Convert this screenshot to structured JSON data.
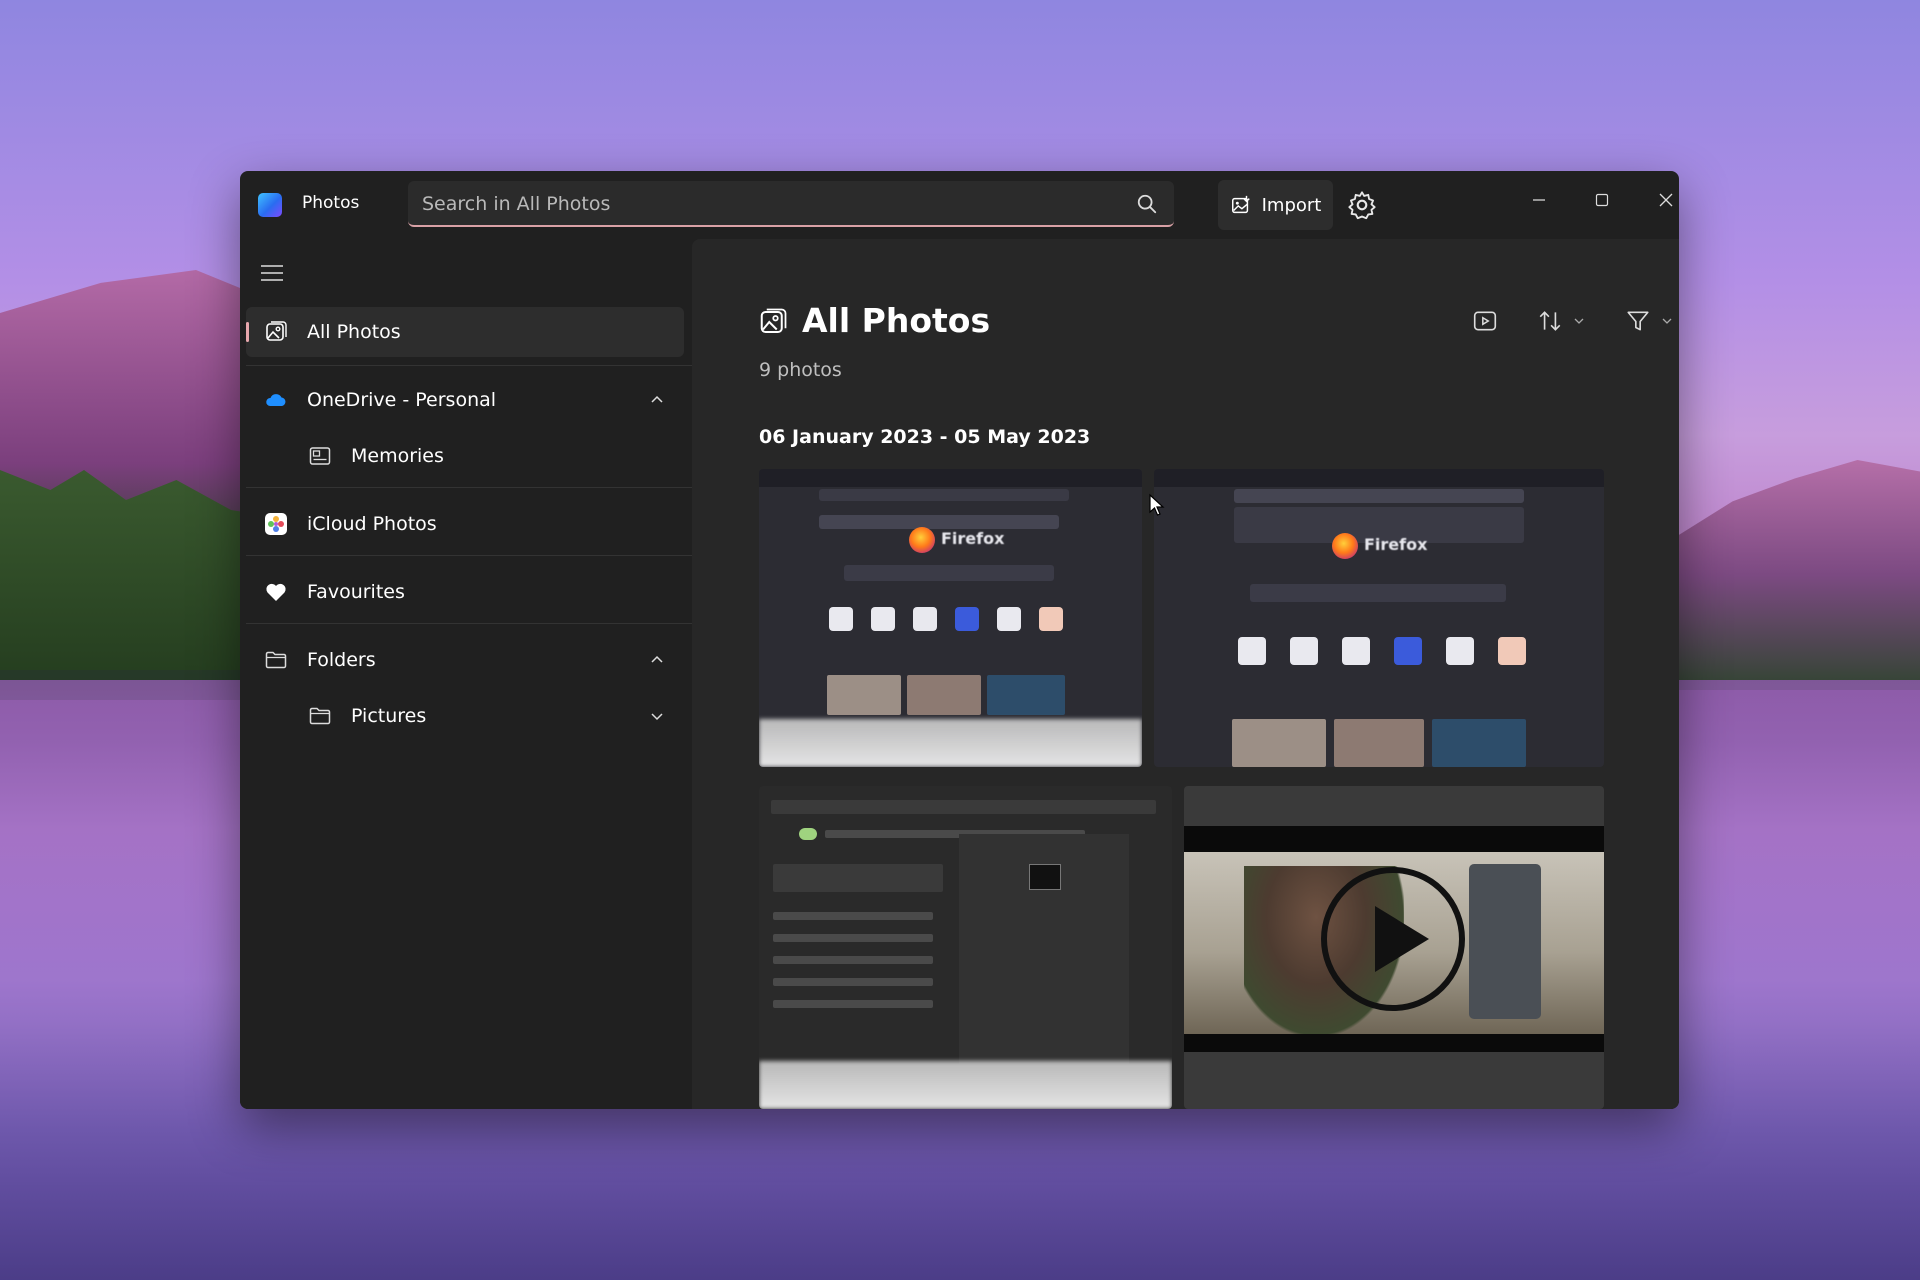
{
  "app": {
    "title": "Photos"
  },
  "search": {
    "placeholder": "Search in All Photos"
  },
  "header": {
    "import_label": "Import"
  },
  "sidebar": {
    "items": [
      {
        "label": "All Photos",
        "icon": "photo-gallery-icon",
        "active": true
      },
      {
        "label": "OneDrive - Personal",
        "icon": "onedrive-icon",
        "expanded": true
      },
      {
        "label": "Memories",
        "icon": "memories-icon"
      },
      {
        "label": "iCloud Photos",
        "icon": "icloud-photos-icon"
      },
      {
        "label": "Favourites",
        "icon": "heart-icon"
      },
      {
        "label": "Folders",
        "icon": "folder-icon",
        "expanded": true
      },
      {
        "label": "Pictures",
        "icon": "folder-icon",
        "expanded": false
      }
    ]
  },
  "main": {
    "title": "All Photos",
    "count": "9 photos",
    "date_range": "06 January 2023 - 05 May 2023",
    "thumbnails": [
      {
        "kind": "screenshot",
        "subject": "Firefox new tab",
        "label": "Firefox"
      },
      {
        "kind": "screenshot",
        "subject": "Firefox new tab",
        "label": "Firefox"
      },
      {
        "kind": "screenshot",
        "subject": "Windows search - Command Prompt"
      },
      {
        "kind": "video",
        "subject": "man holding phone"
      }
    ]
  },
  "colors": {
    "window_bg": "#202020",
    "main_bg": "#272727",
    "accent": "#e7a7ad",
    "text": "#ffffff",
    "muted_text": "#bfbfbf"
  }
}
